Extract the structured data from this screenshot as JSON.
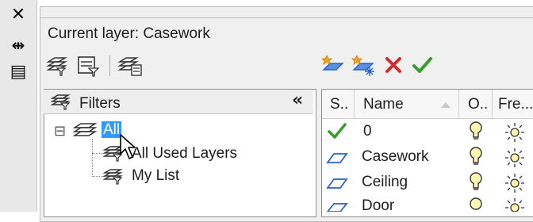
{
  "side": {
    "close_glyph": "✕",
    "autohide_glyph": "⇹",
    "properties_glyph": "▤"
  },
  "header": {
    "current_layer_label": "Current layer: Casework"
  },
  "filters": {
    "title": "Filters",
    "collapse_glyph": "«",
    "tree": {
      "root": {
        "label": "All",
        "expander": "⊟"
      },
      "children": [
        {
          "label": "All Used Layers"
        },
        {
          "label": "My List"
        }
      ]
    }
  },
  "grid": {
    "columns": [
      "S..",
      "Name",
      "O..",
      "Fre..."
    ],
    "rows": [
      {
        "name": "0",
        "status": "current"
      },
      {
        "name": "Casework",
        "status": "layer"
      },
      {
        "name": "Ceiling",
        "status": "layer"
      },
      {
        "name": "Door",
        "status": "layer"
      }
    ]
  },
  "colors": {
    "selection": "#3399ff",
    "check_green": "#3a9c2e",
    "delete_red": "#d22b2b",
    "layer_blue": "#2a64c8"
  }
}
